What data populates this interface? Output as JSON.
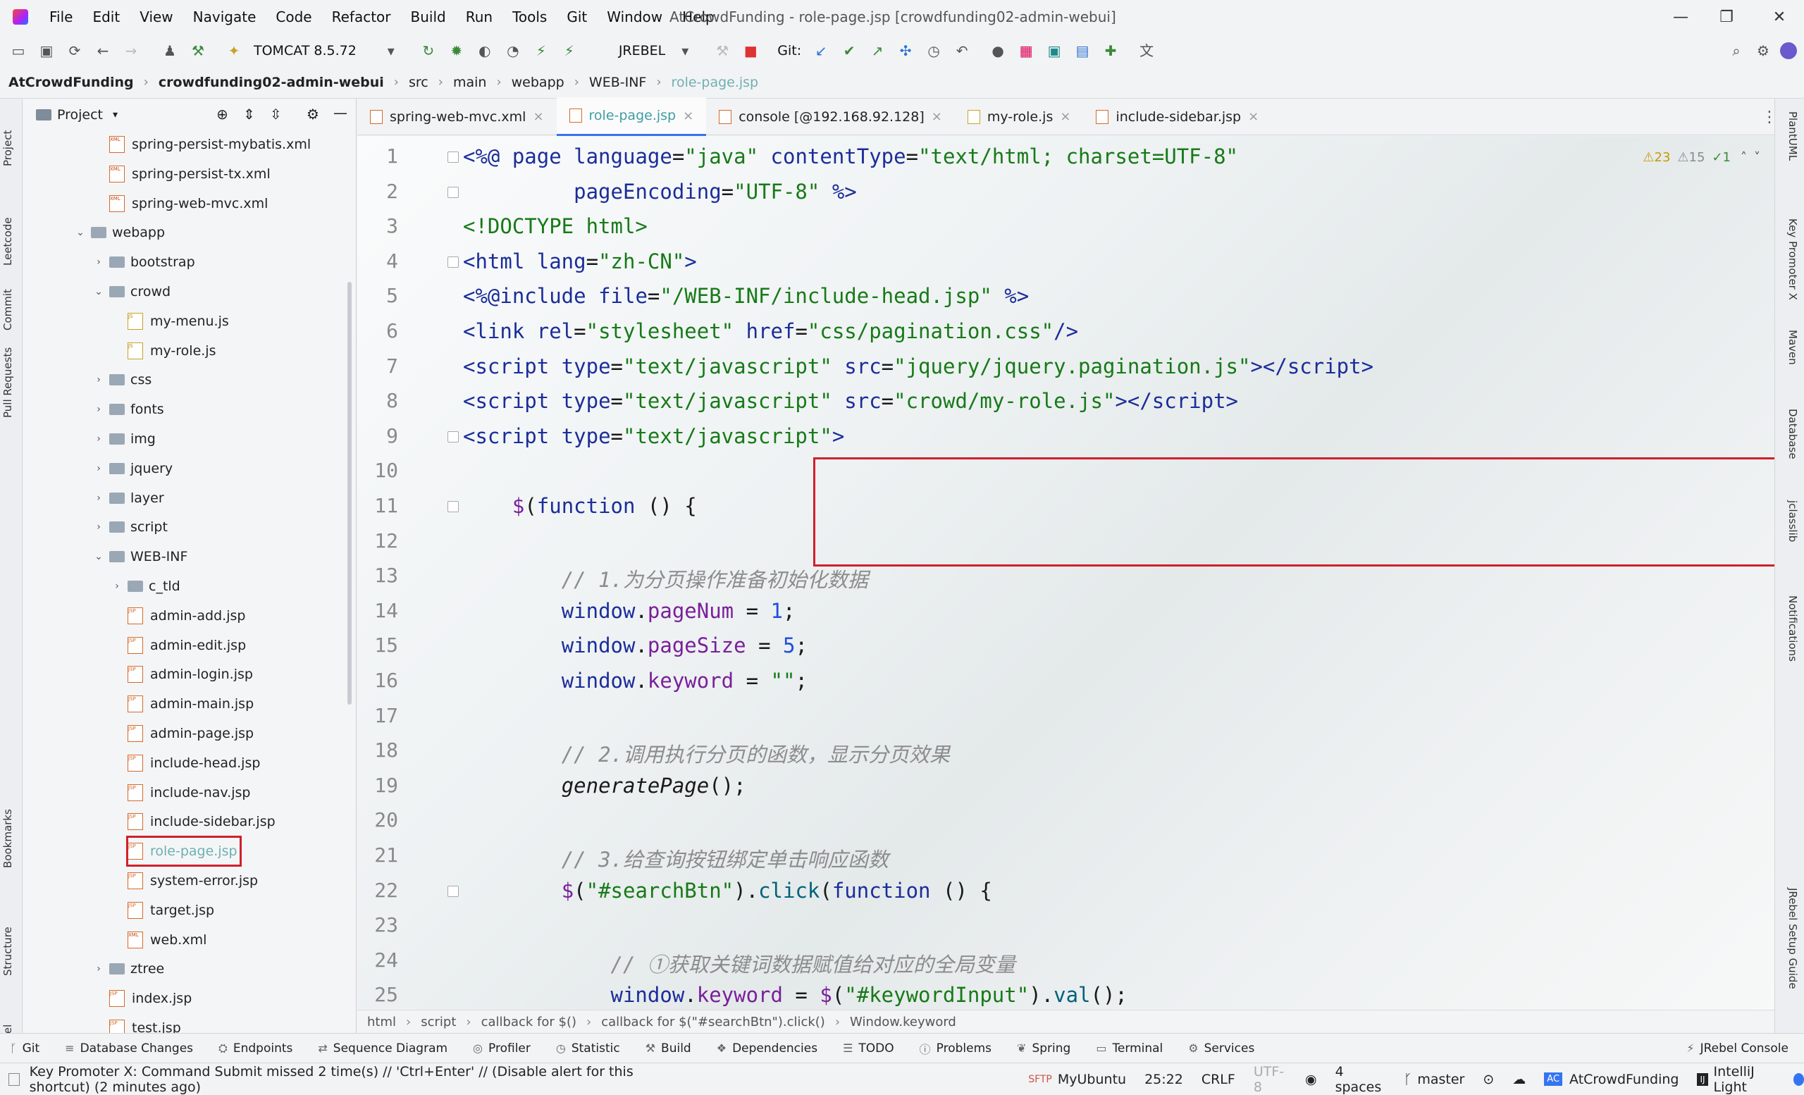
{
  "menu": [
    "File",
    "Edit",
    "View",
    "Navigate",
    "Code",
    "Refactor",
    "Build",
    "Run",
    "Tools",
    "Git",
    "Window",
    "Help"
  ],
  "window_title": "AtCrowdFunding - role-page.jsp [crowdfunding02-admin-webui]",
  "window_controls": {
    "minimize": "—",
    "maximize": "❐",
    "close": "✕"
  },
  "toolbar": {
    "run_config": "TOMCAT 8.5.72",
    "jrebel": "JREBEL",
    "git_label": "Git:"
  },
  "breadcrumb": [
    "AtCrowdFunding",
    "crowdfunding02-admin-webui",
    "src",
    "main",
    "webapp",
    "WEB-INF",
    "role-page.jsp"
  ],
  "project_panel": {
    "title": "Project"
  },
  "project_tree": [
    {
      "label": "spring-persist-mybatis.xml",
      "kind": "xml"
    },
    {
      "label": "spring-persist-tx.xml",
      "kind": "xml"
    },
    {
      "label": "spring-web-mvc.xml",
      "kind": "xml"
    },
    {
      "label": "webapp",
      "kind": "folder",
      "arrow": "⌄"
    },
    {
      "label": "bootstrap",
      "kind": "folder",
      "arrow": "›"
    },
    {
      "label": "crowd",
      "kind": "folder",
      "arrow": "⌄"
    },
    {
      "label": "my-menu.js",
      "kind": "js"
    },
    {
      "label": "my-role.js",
      "kind": "js"
    },
    {
      "label": "css",
      "kind": "folder",
      "arrow": "›"
    },
    {
      "label": "fonts",
      "kind": "folder",
      "arrow": "›"
    },
    {
      "label": "img",
      "kind": "folder",
      "arrow": "›"
    },
    {
      "label": "jquery",
      "kind": "folder",
      "arrow": "›"
    },
    {
      "label": "layer",
      "kind": "folder",
      "arrow": "›"
    },
    {
      "label": "script",
      "kind": "folder",
      "arrow": "›"
    },
    {
      "label": "WEB-INF",
      "kind": "folder",
      "arrow": "⌄"
    },
    {
      "label": "c_tld",
      "kind": "folder",
      "arrow": "›"
    },
    {
      "label": "admin-add.jsp",
      "kind": "jsp"
    },
    {
      "label": "admin-edit.jsp",
      "kind": "jsp"
    },
    {
      "label": "admin-login.jsp",
      "kind": "jsp"
    },
    {
      "label": "admin-main.jsp",
      "kind": "jsp"
    },
    {
      "label": "admin-page.jsp",
      "kind": "jsp"
    },
    {
      "label": "include-head.jsp",
      "kind": "jsp"
    },
    {
      "label": "include-nav.jsp",
      "kind": "jsp"
    },
    {
      "label": "include-sidebar.jsp",
      "kind": "jsp"
    },
    {
      "label": "role-page.jsp",
      "kind": "jsp",
      "selected": true
    },
    {
      "label": "system-error.jsp",
      "kind": "jsp"
    },
    {
      "label": "target.jsp",
      "kind": "jsp"
    },
    {
      "label": "web.xml",
      "kind": "xml"
    },
    {
      "label": "ztree",
      "kind": "folder",
      "arrow": "›"
    },
    {
      "label": "index.jsp",
      "kind": "jsp"
    },
    {
      "label": "test.jsp",
      "kind": "jsp"
    }
  ],
  "editor_tabs": [
    {
      "label": "spring-web-mvc.xml",
      "active": false
    },
    {
      "label": "role-page.jsp",
      "active": true
    },
    {
      "label": "console [@192.168.92.128]",
      "active": false
    },
    {
      "label": "my-role.js",
      "active": false
    },
    {
      "label": "include-sidebar.jsp",
      "active": false
    }
  ],
  "inspections": {
    "warnings": "⚠23",
    "weak": "⚠15",
    "ok": "✓1"
  },
  "code_lines": [
    "<span class=\"tag\">&lt;%@ page </span><span class=\"attr\">language</span>=<span class=\"str\">\"java\"</span> <span class=\"attr\">contentType</span>=<span class=\"str\">\"text/html; charset=UTF-8\"</span>",
    "         <span class=\"attr\">pageEncoding</span>=<span class=\"str\">\"UTF-8\"</span> <span class=\"tag\">%&gt;</span>",
    "<span class=\"str\">&lt;!DOCTYPE html&gt;</span>",
    "<span class=\"tag\">&lt;html </span><span class=\"attr\">lang</span>=<span class=\"str\">\"zh-CN\"</span><span class=\"tag\">&gt;</span>",
    "<span class=\"tag\">&lt;%@include </span><span class=\"attr\">file</span>=<span class=\"str\">\"/WEB-INF/include-head.jsp\"</span> <span class=\"tag\">%&gt;</span>",
    "<span class=\"tag\">&lt;link </span><span class=\"attr\">rel</span>=<span class=\"str\">\"stylesheet\"</span> <span class=\"attr\">href</span>=<span class=\"str\">\"css/pagination.css\"</span><span class=\"tag\">/&gt;</span>",
    "<span class=\"tag\">&lt;script </span><span class=\"attr\">type</span>=<span class=\"str\">\"text/javascript\"</span> <span class=\"attr\">src</span>=<span class=\"str\">\"jquery/jquery.pagination.js\"</span><span class=\"tag\">&gt;&lt;/script&gt;</span>",
    "<span class=\"tag\">&lt;script </span><span class=\"attr\">type</span>=<span class=\"str\">\"text/javascript\"</span> <span class=\"attr\">src</span>=<span class=\"str\">\"crowd/my-role.js\"</span><span class=\"tag\">&gt;&lt;/script&gt;</span>",
    "<span class=\"tag\">&lt;script </span><span class=\"attr\">type</span>=<span class=\"str\">\"text/javascript\"</span><span class=\"tag\">&gt;</span>",
    "",
    "    <span class=\"prop\">$</span>(<span class=\"kw\">function</span> () {",
    "",
    "        <span class=\"cmt\">// 1.为分页操作准备初始化数据</span>",
    "        <span class=\"kw\">window</span>.<span class=\"prop\">pageNum</span> = <span class=\"num\">1</span>;",
    "        <span class=\"kw\">window</span>.<span class=\"prop\">pageSize</span> = <span class=\"num\">5</span>;",
    "        <span class=\"kw\">window</span>.<span class=\"prop\">keyword</span> = <span class=\"str\">\"\"</span>;",
    "",
    "        <span class=\"cmt\">// 2.调用执行分页的函数，显示分页效果</span>",
    "        <i>generatePage</i>();",
    "",
    "        <span class=\"cmt\">// 3.给查询按钮绑定单击响应函数</span>",
    "        <span class=\"prop\">$</span>(<span class=\"str\">\"#searchBtn\"</span>).<span class=\"fn\">click</span>(<span class=\"kw\">function</span> () {",
    "",
    "            <span class=\"cmt\">// ①获取关键词数据赋值给对应的全局变量</span>",
    "            <span class=\"kw\">window</span>.<span class=\"prop\">keyword</span> = <span class=\"prop\">$</span>(<span class=\"str\">\"#keywordInput\"</span>).<span class=\"fn\">val</span>();"
  ],
  "editor_breadcrumb": [
    "html",
    "script",
    "callback for $()",
    "callback for $(\"#searchBtn\").click()",
    "Window.keyword"
  ],
  "left_stripe": [
    "Project",
    "Leetcode",
    "Commit",
    "Pull Requests",
    "Bookmarks",
    "Structure",
    "JRebel"
  ],
  "right_stripe": [
    "PlantUML",
    "Key Promoter X",
    "Maven",
    "Database",
    "jclasslib",
    "Notifications",
    "JRebel Setup Guide"
  ],
  "tool_windows": [
    "Git",
    "Database Changes",
    "Endpoints",
    "Sequence Diagram",
    "Profiler",
    "Statistic",
    "Build",
    "Dependencies",
    "TODO",
    "Problems",
    "Spring",
    "Terminal",
    "Services",
    "JRebel Console"
  ],
  "status": {
    "message": "Key Promoter X: Command Submit missed 2 time(s) // 'Ctrl+Enter' // (Disable alert for this shortcut) (2 minutes ago)",
    "sftp": "MyUbuntu",
    "position": "25:22",
    "line_sep": "CRLF",
    "encoding": "UTF-8",
    "indent": "4 spaces",
    "branch": "master",
    "project": "AtCrowdFunding",
    "theme": "IntelliJ Light"
  }
}
